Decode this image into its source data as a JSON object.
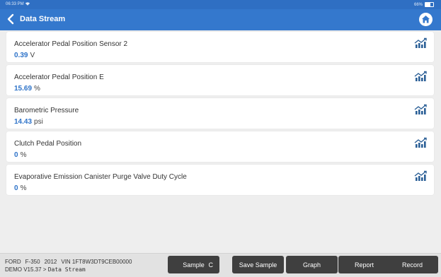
{
  "status": {
    "time": "06:33 PM",
    "battery": "66%"
  },
  "header": {
    "title": "Data Stream"
  },
  "items": [
    {
      "name": "Accelerator Pedal Position Sensor 2",
      "value": "0.39",
      "unit": "V"
    },
    {
      "name": "Accelerator Pedal Position E",
      "value": "15.69",
      "unit": "%"
    },
    {
      "name": "Barometric Pressure",
      "value": "14.43",
      "unit": "psi"
    },
    {
      "name": "Clutch Pedal Position",
      "value": "0",
      "unit": "%"
    },
    {
      "name": "Evaporative Emission Canister Purge Valve Duty Cycle",
      "value": "0",
      "unit": "%"
    }
  ],
  "footer": {
    "make": "FORD",
    "model": "F-350",
    "year": "2012",
    "vin": "VIN  1FT8W3DT9CEB00000",
    "version": "DEMO V15.37 >",
    "crumb": "Data Stream",
    "buttons": {
      "sample": "Sample",
      "sample_suffix": "C",
      "save_sample": "Save Sample",
      "graph": "Graph",
      "report": "Report",
      "record": "Record"
    }
  },
  "colors": {
    "header": "#3478cd",
    "value": "#2e73c9",
    "button": "#3f3f3f"
  },
  "icons": {
    "back": "chevron-left-icon",
    "home": "home-icon",
    "graph": "chart-icon",
    "wifi": "wifi-icon",
    "battery": "battery-icon"
  }
}
